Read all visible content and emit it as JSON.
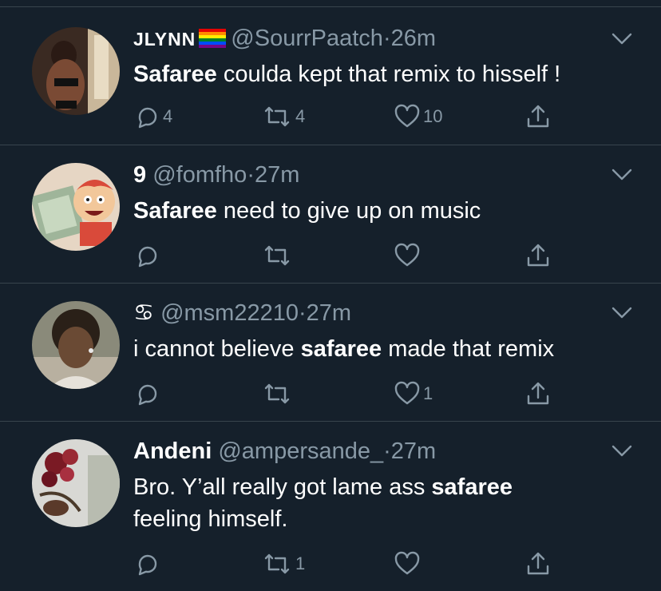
{
  "colors": {
    "background": "#15202b",
    "text": "#ffffff",
    "muted": "#8899a6",
    "divider": "#38444d"
  },
  "icons": {
    "reply": "reply-icon",
    "retweet": "retweet-icon",
    "like": "heart-icon",
    "share": "share-icon",
    "more": "chevron-down-icon"
  },
  "tweets": [
    {
      "name": "JLYNN",
      "name_badge": "rainbow-flag-emoji",
      "handle": "@SourrPaatch",
      "dot": "·",
      "time": "26m",
      "text_parts": [
        "Safaree",
        " coulda kept that remix to hisself  !"
      ],
      "reply_count": "4",
      "retweet_count": "4",
      "like_count": "10"
    },
    {
      "name": "9",
      "handle": "@fomfho",
      "dot": "·",
      "time": "27m",
      "text_parts": [
        "Safaree",
        " need to give up on music"
      ],
      "reply_count": "",
      "retweet_count": "",
      "like_count": ""
    },
    {
      "name": "♋︎",
      "handle": "@msm22210",
      "dot": "·",
      "time": "27m",
      "text_parts": [
        "i cannot believe ",
        "safaree",
        " made that remix"
      ],
      "reply_count": "",
      "retweet_count": "",
      "like_count": "1"
    },
    {
      "name": "Andeni",
      "handle": "@ampersande_",
      "dot": "·",
      "time": "27m",
      "text_line1": [
        "Bro. Y’all really got lame ass ",
        "safaree"
      ],
      "text_line2": "feeling himself.",
      "reply_count": "",
      "retweet_count": "1",
      "like_count": ""
    }
  ]
}
